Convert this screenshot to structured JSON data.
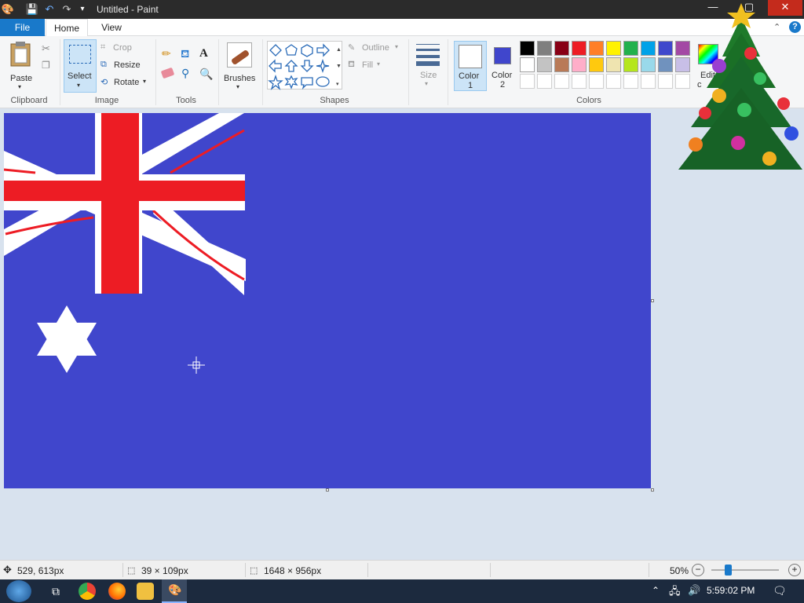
{
  "window": {
    "title": "Untitled - Paint",
    "minimize": "—",
    "maximize": "▢",
    "close": "✕"
  },
  "tabs": {
    "file": "File",
    "home": "Home",
    "view": "View"
  },
  "ribbon": {
    "clipboard": {
      "paste": "Paste",
      "group": "Clipboard"
    },
    "image": {
      "select": "Select",
      "crop": "Crop",
      "resize": "Resize",
      "rotate": "Rotate",
      "group": "Image"
    },
    "tools": {
      "group": "Tools"
    },
    "brushes": {
      "label": "Brushes"
    },
    "shapes": {
      "outline": "Outline",
      "fill": "Fill",
      "group": "Shapes"
    },
    "size": {
      "label": "Size"
    },
    "color1": {
      "label1": "Color",
      "label2": "1",
      "value": "#ffffff"
    },
    "color2": {
      "label1": "Color",
      "label2": "2",
      "value": "#4046cc"
    },
    "colors": {
      "group": "Colors",
      "edit": "Edit",
      "edit2": "c",
      "row1": [
        "#000000",
        "#7f7f7f",
        "#880015",
        "#ed1c24",
        "#ff7f27",
        "#fff200",
        "#22b14c",
        "#00a2e8",
        "#3f48cc",
        "#a349a4"
      ],
      "row2": [
        "#ffffff",
        "#c3c3c3",
        "#b97a57",
        "#ffaec9",
        "#ffc90e",
        "#efe4b0",
        "#b5e61d",
        "#99d9ea",
        "#7092be",
        "#c8bfe7"
      ],
      "row3": [
        "#ffffff",
        "#ffffff",
        "#ffffff",
        "#ffffff",
        "#ffffff",
        "#ffffff",
        "#ffffff",
        "#ffffff",
        "#ffffff",
        "#ffffff"
      ]
    }
  },
  "canvas": {
    "background": "#4046cc"
  },
  "status": {
    "cursor_pos": "529, 613px",
    "selection_size": "39 × 109px",
    "image_size": "1648 × 956px",
    "zoom": "50%",
    "zoom_level": 0.5
  },
  "taskbar": {
    "clock": "5:59:02 PM"
  }
}
